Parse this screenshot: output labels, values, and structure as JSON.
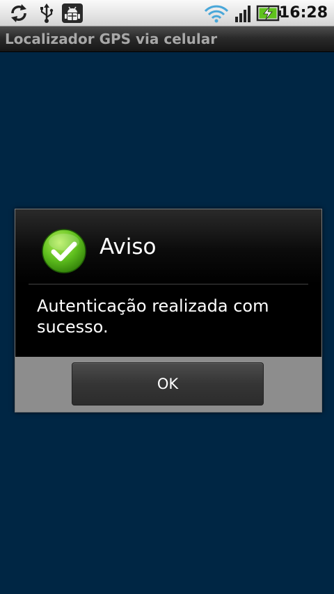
{
  "status_bar": {
    "time": "16:28",
    "icons": [
      "sync-icon",
      "usb-icon",
      "debug-icon",
      "wifi-icon",
      "signal-icon",
      "battery-charging-icon"
    ]
  },
  "app": {
    "title": "Localizador GPS via celular"
  },
  "dialog": {
    "title": "Aviso",
    "icon": "success-check-icon",
    "message": "Autenticação realizada com sucesso.",
    "ok_label": "OK"
  },
  "colors": {
    "background": "#002544",
    "status_bar": "#e6e6e6",
    "title_bar": "#2b2b2b",
    "dialog": "#000000",
    "footer": "#8d8d8d",
    "success_green": "#5fbf1e"
  }
}
